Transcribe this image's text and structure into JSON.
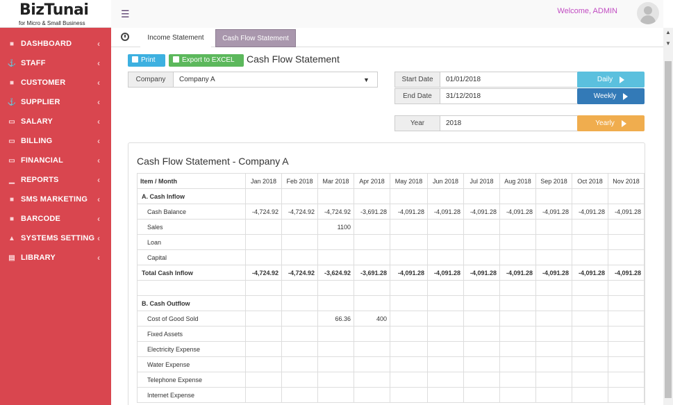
{
  "brand": {
    "title": "BizTunai",
    "subtitle": "for Micro & Small Business"
  },
  "sidebar": {
    "items": [
      {
        "label": "DASHBOARD",
        "icon": "users-icon"
      },
      {
        "label": "STAFF",
        "icon": "anchor-icon"
      },
      {
        "label": "CUSTOMER",
        "icon": "users-icon"
      },
      {
        "label": "SUPPLIER",
        "icon": "anchor-icon"
      },
      {
        "label": "SALARY",
        "icon": "money-icon"
      },
      {
        "label": "BILLING",
        "icon": "money-icon"
      },
      {
        "label": "FINANCIAL",
        "icon": "money-icon"
      },
      {
        "label": "REPORTS",
        "icon": "bar-chart-icon"
      },
      {
        "label": "SMS MARKETING",
        "icon": "users-icon"
      },
      {
        "label": "BARCODE",
        "icon": "users-icon"
      },
      {
        "label": "SYSTEMS SETTING",
        "icon": "bank-icon"
      },
      {
        "label": "LIBRARY",
        "icon": "book-icon"
      }
    ]
  },
  "topbar": {
    "welcome": "Welcome, ADMIN"
  },
  "tabs": [
    {
      "label": "Income Statement"
    },
    {
      "label": "Cash Flow Statement",
      "active": true
    }
  ],
  "toolbar": {
    "print_label": "Print",
    "excel_label": "Export to EXCEL",
    "page_title": "Cash Flow Statement"
  },
  "filters": {
    "company_label": "Company",
    "company_value": "Company A",
    "start_label": "Start Date",
    "start_value": "01/01/2018",
    "end_label": "End Date",
    "end_value": "31/12/2018",
    "year_label": "Year",
    "year_value": "2018",
    "daily_label": "Daily",
    "weekly_label": "Weekly",
    "yearly_label": "Yearly"
  },
  "report": {
    "title": "Cash Flow Statement - Company A",
    "header": [
      "Item / Month",
      "Jan 2018",
      "Feb 2018",
      "Mar 2018",
      "Apr 2018",
      "May 2018",
      "Jun 2018",
      "Jul 2018",
      "Aug 2018",
      "Sep 2018",
      "Oct 2018",
      "Nov 2018"
    ],
    "rows": [
      {
        "cells": [
          "A. Cash Inflow",
          "",
          "",
          "",
          "",
          "",
          "",
          "",
          "",
          "",
          "",
          ""
        ],
        "type": "section"
      },
      {
        "cells": [
          "Cash Balance",
          "-4,724.92",
          "-4,724.92",
          "-4,724.92",
          "-3,691.28",
          "-4,091.28",
          "-4,091.28",
          "-4,091.28",
          "-4,091.28",
          "-4,091.28",
          "-4,091.28",
          "-4,091.28"
        ],
        "type": "item"
      },
      {
        "cells": [
          "Sales",
          "",
          "",
          "1100",
          "",
          "",
          "",
          "",
          "",
          "",
          "",
          ""
        ],
        "type": "item"
      },
      {
        "cells": [
          "Loan",
          "",
          "",
          "",
          "",
          "",
          "",
          "",
          "",
          "",
          "",
          ""
        ],
        "type": "item"
      },
      {
        "cells": [
          "Capital",
          "",
          "",
          "",
          "",
          "",
          "",
          "",
          "",
          "",
          "",
          ""
        ],
        "type": "item"
      },
      {
        "cells": [
          "Total Cash Inflow",
          "-4,724.92",
          "-4,724.92",
          "-3,624.92",
          "-3,691.28",
          "-4,091.28",
          "-4,091.28",
          "-4,091.28",
          "-4,091.28",
          "-4,091.28",
          "-4,091.28",
          "-4,091.28"
        ],
        "type": "total"
      },
      {
        "cells": [
          "",
          "",
          "",
          "",
          "",
          "",
          "",
          "",
          "",
          "",
          "",
          ""
        ],
        "type": "blank"
      },
      {
        "cells": [
          "B. Cash Outflow",
          "",
          "",
          "",
          "",
          "",
          "",
          "",
          "",
          "",
          "",
          ""
        ],
        "type": "section"
      },
      {
        "cells": [
          "Cost of Good Sold",
          "",
          "",
          "66.36",
          "400",
          "",
          "",
          "",
          "",
          "",
          "",
          ""
        ],
        "type": "item"
      },
      {
        "cells": [
          "Fixed Assets",
          "",
          "",
          "",
          "",
          "",
          "",
          "",
          "",
          "",
          "",
          ""
        ],
        "type": "item"
      },
      {
        "cells": [
          "Electricity Expense",
          "",
          "",
          "",
          "",
          "",
          "",
          "",
          "",
          "",
          "",
          ""
        ],
        "type": "item"
      },
      {
        "cells": [
          "Water Expense",
          "",
          "",
          "",
          "",
          "",
          "",
          "",
          "",
          "",
          "",
          ""
        ],
        "type": "item"
      },
      {
        "cells": [
          "Telephone Expense",
          "",
          "",
          "",
          "",
          "",
          "",
          "",
          "",
          "",
          "",
          ""
        ],
        "type": "item"
      },
      {
        "cells": [
          "Internet Expense",
          "",
          "",
          "",
          "",
          "",
          "",
          "",
          "",
          "",
          "",
          ""
        ],
        "type": "item"
      }
    ]
  }
}
